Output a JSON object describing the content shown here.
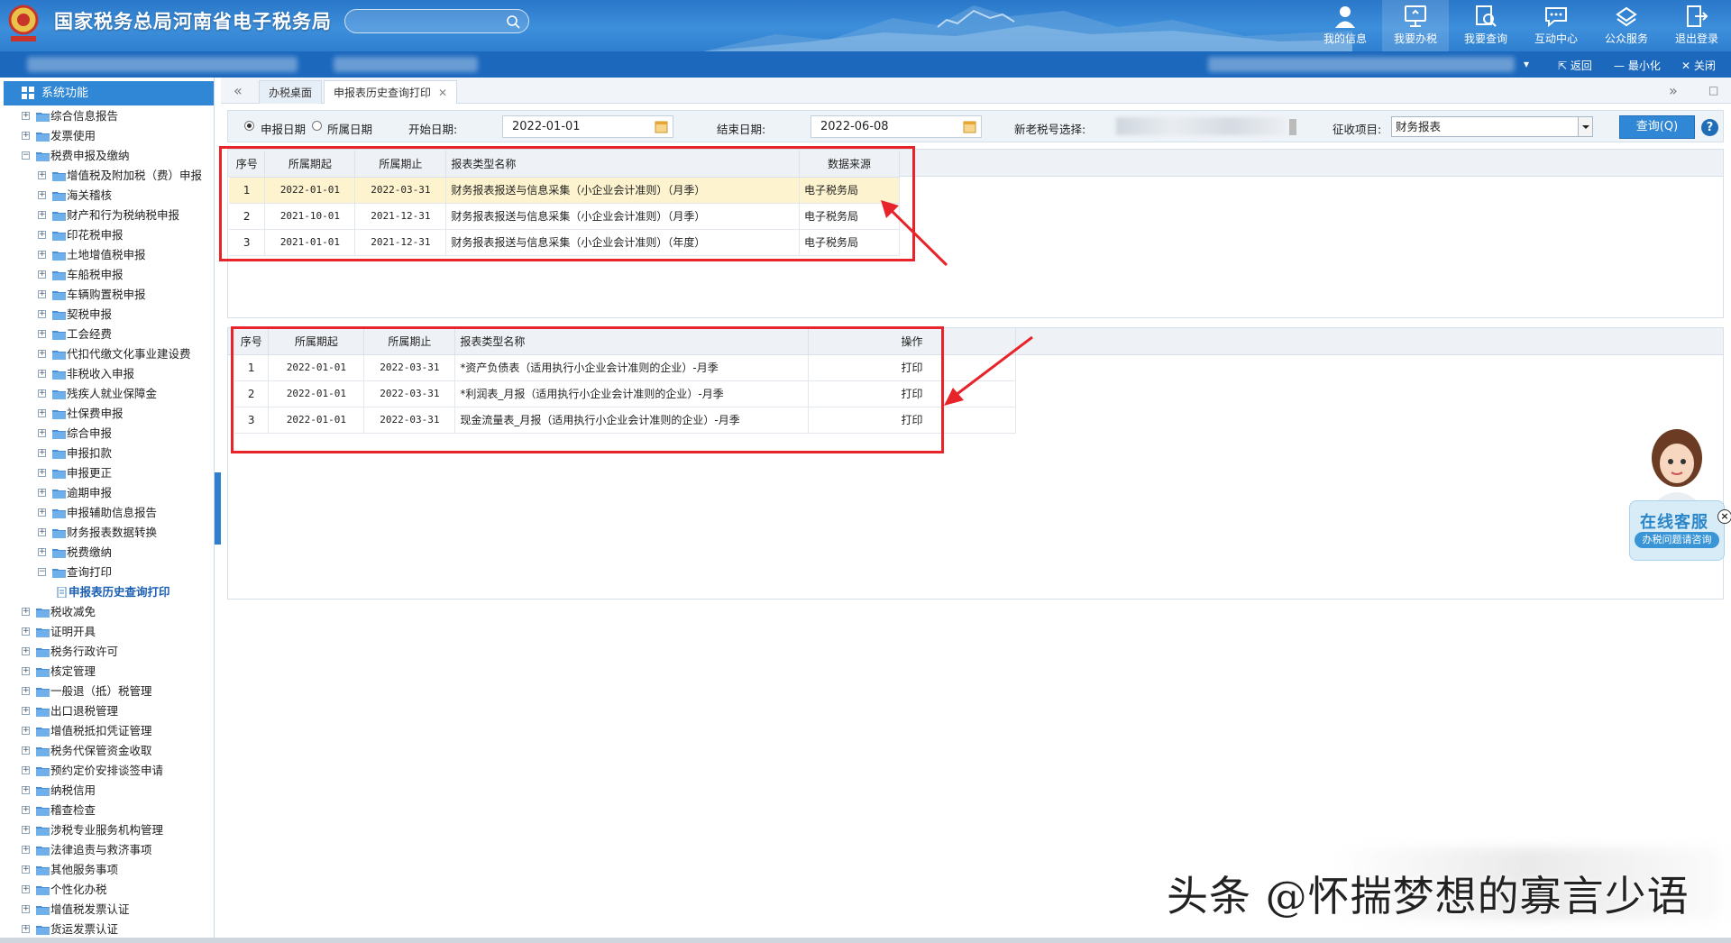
{
  "header": {
    "site_title": "国家税务总局河南省电子税务局",
    "search_placeholder": "",
    "nav": [
      {
        "label": "我的信息",
        "icon": "user-icon"
      },
      {
        "label": "我要办税",
        "icon": "monitor-icon"
      },
      {
        "label": "我要查询",
        "icon": "query-icon"
      },
      {
        "label": "互动中心",
        "icon": "chat-icon"
      },
      {
        "label": "公众服务",
        "icon": "service-icon"
      },
      {
        "label": "退出登录",
        "icon": "logout-icon"
      }
    ]
  },
  "subbar": {
    "back": "返回",
    "minimize": "最小化",
    "close": "关闭"
  },
  "sidebar": {
    "title": "系统功能",
    "items": [
      {
        "label": "综合信息报告",
        "level": 0,
        "toggle": "+"
      },
      {
        "label": "发票使用",
        "level": 0,
        "toggle": "+"
      },
      {
        "label": "税费申报及缴纳",
        "level": 0,
        "toggle": "-"
      },
      {
        "label": "增值税及附加税（费）申报",
        "level": 1,
        "toggle": "+"
      },
      {
        "label": "海关稽核",
        "level": 1,
        "toggle": "+"
      },
      {
        "label": "财产和行为税纳税申报",
        "level": 1,
        "toggle": "+"
      },
      {
        "label": "印花税申报",
        "level": 1,
        "toggle": "+"
      },
      {
        "label": "土地增值税申报",
        "level": 1,
        "toggle": "+"
      },
      {
        "label": "车船税申报",
        "level": 1,
        "toggle": "+"
      },
      {
        "label": "车辆购置税申报",
        "level": 1,
        "toggle": "+"
      },
      {
        "label": "契税申报",
        "level": 1,
        "toggle": "+"
      },
      {
        "label": "工会经费",
        "level": 1,
        "toggle": "+"
      },
      {
        "label": "代扣代缴文化事业建设费",
        "level": 1,
        "toggle": "+"
      },
      {
        "label": "非税收入申报",
        "level": 1,
        "toggle": "+"
      },
      {
        "label": "残疾人就业保障金",
        "level": 1,
        "toggle": "+"
      },
      {
        "label": "社保费申报",
        "level": 1,
        "toggle": "+"
      },
      {
        "label": "综合申报",
        "level": 1,
        "toggle": "+"
      },
      {
        "label": "申报扣款",
        "level": 1,
        "toggle": "+"
      },
      {
        "label": "申报更正",
        "level": 1,
        "toggle": "+"
      },
      {
        "label": "逾期申报",
        "level": 1,
        "toggle": "+"
      },
      {
        "label": "申报辅助信息报告",
        "level": 1,
        "toggle": "+"
      },
      {
        "label": "财务报表数据转换",
        "level": 1,
        "toggle": "+"
      },
      {
        "label": "税费缴纳",
        "level": 1,
        "toggle": "+"
      },
      {
        "label": "查询打印",
        "level": 1,
        "toggle": "-"
      },
      {
        "label": "申报表历史查询打印",
        "level": 2,
        "toggle": ""
      },
      {
        "label": "税收减免",
        "level": 0,
        "toggle": "+"
      },
      {
        "label": "证明开具",
        "level": 0,
        "toggle": "+"
      },
      {
        "label": "税务行政许可",
        "level": 0,
        "toggle": "+"
      },
      {
        "label": "核定管理",
        "level": 0,
        "toggle": "+"
      },
      {
        "label": "一般退（抵）税管理",
        "level": 0,
        "toggle": "+"
      },
      {
        "label": "出口退税管理",
        "level": 0,
        "toggle": "+"
      },
      {
        "label": "增值税抵扣凭证管理",
        "level": 0,
        "toggle": "+"
      },
      {
        "label": "税务代保管资金收取",
        "level": 0,
        "toggle": "+"
      },
      {
        "label": "预约定价安排谈签申请",
        "level": 0,
        "toggle": "+"
      },
      {
        "label": "纳税信用",
        "level": 0,
        "toggle": "+"
      },
      {
        "label": "稽查检查",
        "level": 0,
        "toggle": "+"
      },
      {
        "label": "涉税专业服务机构管理",
        "level": 0,
        "toggle": "+"
      },
      {
        "label": "法律追责与救济事项",
        "level": 0,
        "toggle": "+"
      },
      {
        "label": "其他服务事项",
        "level": 0,
        "toggle": "+"
      },
      {
        "label": "个性化办税",
        "level": 0,
        "toggle": "+"
      },
      {
        "label": "增值税发票认证",
        "level": 0,
        "toggle": "+"
      },
      {
        "label": "货运发票认证",
        "level": 0,
        "toggle": "+"
      }
    ]
  },
  "tabs": [
    {
      "label": "办税桌面",
      "active": false
    },
    {
      "label": "申报表历史查询打印",
      "active": true
    }
  ],
  "filter": {
    "radio_declare": "申报日期",
    "radio_period": "所属日期",
    "start_label": "开始日期:",
    "start_value": "2022-01-01",
    "end_label": "结束日期:",
    "end_value": "2022-06-08",
    "taxno_label": "新老税号选择:",
    "item_label": "征收项目:",
    "item_value": "财务报表",
    "query_button": "查询(Q)",
    "help": "?"
  },
  "table1": {
    "headers": [
      "序号",
      "所属期起",
      "所属期止",
      "报表类型名称",
      "数据来源"
    ],
    "rows": [
      [
        "1",
        "2022-01-01",
        "2022-03-31",
        "财务报表报送与信息采集（小企业会计准则）（月季）",
        "电子税务局"
      ],
      [
        "2",
        "2021-10-01",
        "2021-12-31",
        "财务报表报送与信息采集（小企业会计准则）（月季）",
        "电子税务局"
      ],
      [
        "3",
        "2021-01-01",
        "2021-12-31",
        "财务报表报送与信息采集（小企业会计准则）（年度）",
        "电子税务局"
      ]
    ]
  },
  "table2": {
    "headers": [
      "序号",
      "所属期起",
      "所属期止",
      "报表类型名称",
      "操作"
    ],
    "rows": [
      [
        "1",
        "2022-01-01",
        "2022-03-31",
        "*资产负债表（适用执行小企业会计准则的企业）-月季",
        "打印"
      ],
      [
        "2",
        "2022-01-01",
        "2022-03-31",
        "*利润表_月报（适用执行小企业会计准则的企业）-月季",
        "打印"
      ],
      [
        "3",
        "2022-01-01",
        "2022-03-31",
        "现金流量表_月报（适用执行小企业会计准则的企业）-月季",
        "打印"
      ]
    ]
  },
  "customer_service": {
    "title": "在线客服",
    "subtitle": "办税问题请咨询"
  },
  "watermark": "头条 @怀揣梦想的寡言少语",
  "colors": {
    "header_blue": "#2f7fd0",
    "highlight_red": "#e8242b",
    "selected_row": "#fdf3cf"
  }
}
